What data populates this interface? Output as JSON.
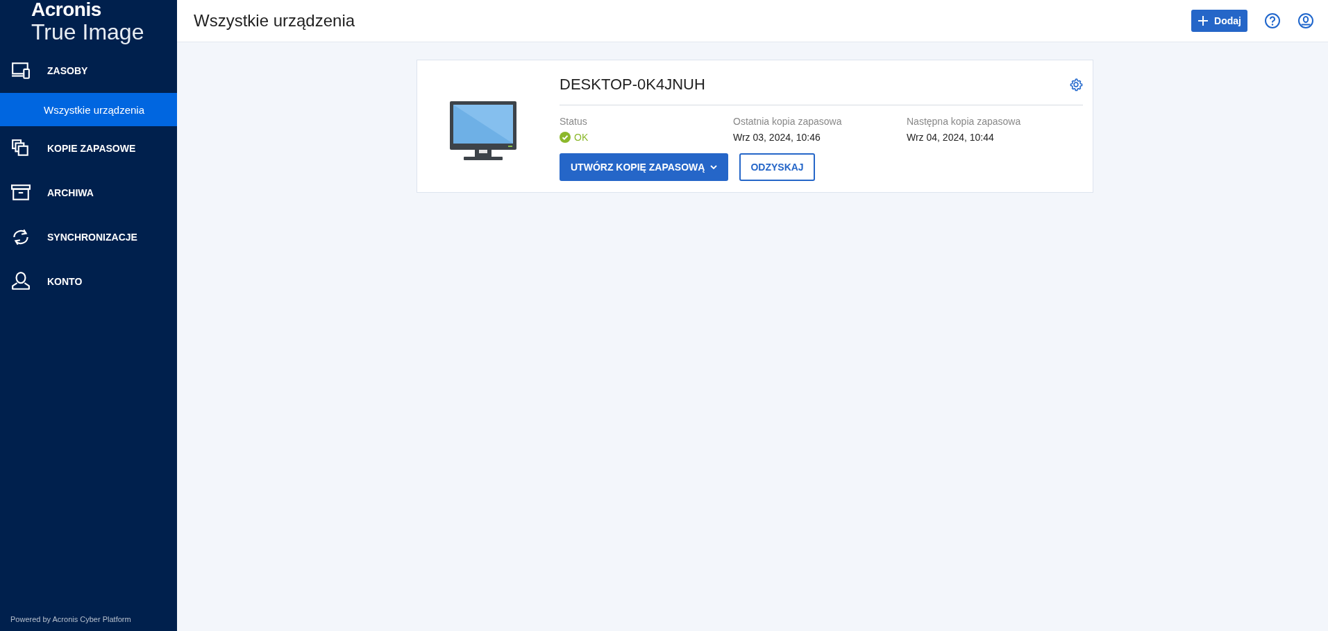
{
  "sidebar": {
    "logo": {
      "brand": "Acronis",
      "product": "True Image"
    },
    "items": [
      {
        "label": "ZASOBY",
        "selected": false,
        "children": [
          {
            "label": "Wszystkie urządzenia",
            "selected": true
          }
        ]
      },
      {
        "label": "KOPIE ZAPASOWE",
        "selected": false
      },
      {
        "label": "ARCHIWA",
        "selected": false
      },
      {
        "label": "SYNCHRONIZACJE",
        "selected": false
      },
      {
        "label": "KONTO",
        "selected": false
      }
    ],
    "footer": "Powered by Acronis Cyber Platform"
  },
  "header": {
    "title": "Wszystkie urządzenia",
    "add_button": "Dodaj"
  },
  "device": {
    "name": "DESKTOP-0K4JNUH",
    "fields": [
      {
        "label": "Status",
        "value": "OK",
        "kind": "status"
      },
      {
        "label": "Ostatnia kopia zapasowa",
        "value": "Wrz 03, 2024, 10:46",
        "kind": "text"
      },
      {
        "label": "Następna kopia zapasowa",
        "value": "Wrz 04, 2024, 10:44",
        "kind": "text"
      }
    ],
    "buttons": [
      {
        "label": "UTWÓRZ KOPIĘ ZAPASOWĄ",
        "kind": "primary"
      },
      {
        "label": "ODZYSKAJ",
        "kind": "outline"
      }
    ]
  }
}
